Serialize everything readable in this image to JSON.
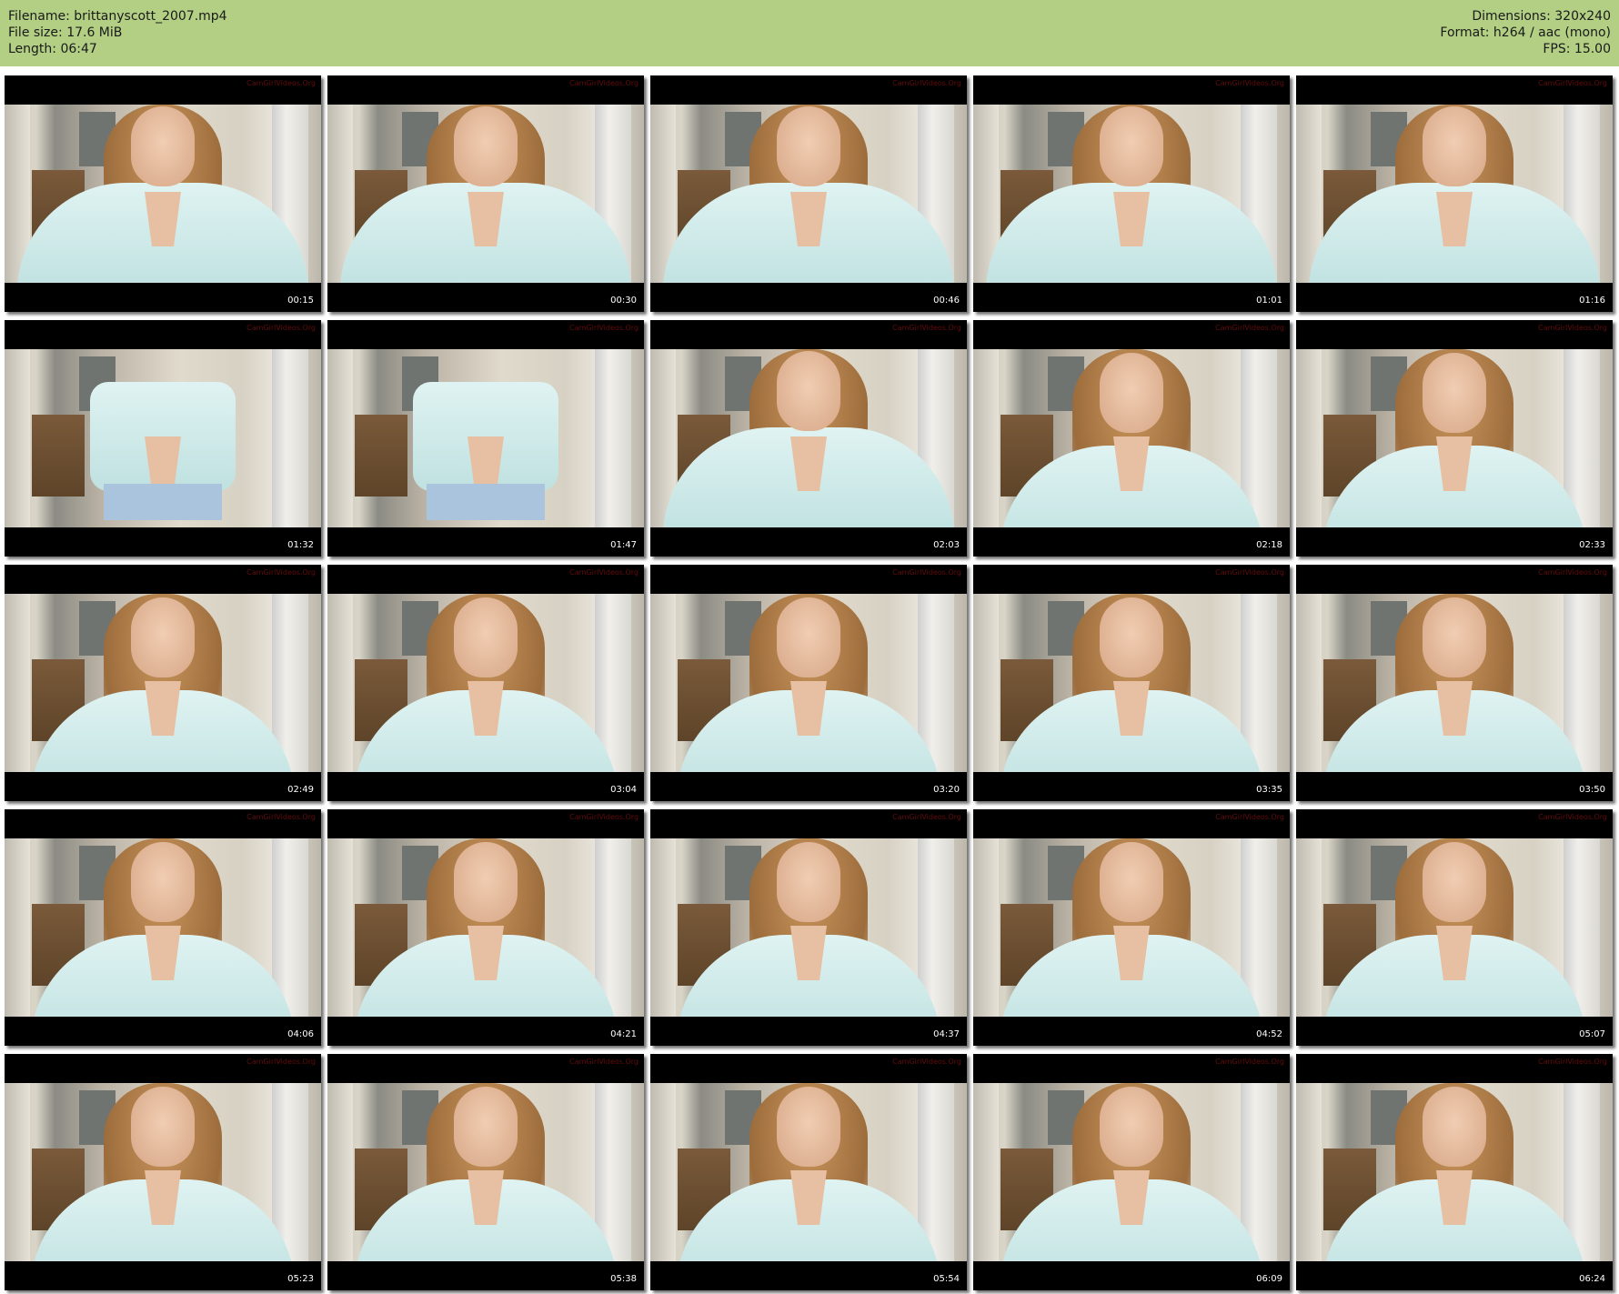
{
  "header": {
    "filename_line": "Filename: brittanyscott_2007.mp4",
    "filesize_line": "File size: 17.6 MiB",
    "length_line": "Length: 06:47",
    "dimensions_line": "Dimensions: 320x240",
    "format_line": "Format: h264 / aac (mono)",
    "fps_line": "FPS: 15.00",
    "background_color": "#b2cf84"
  },
  "watermark_text": "CamGirlVideos.Org",
  "thumbnails": [
    {
      "time": "00:15",
      "scene": "lean"
    },
    {
      "time": "00:30",
      "scene": "lean"
    },
    {
      "time": "00:46",
      "scene": "lean"
    },
    {
      "time": "01:01",
      "scene": "lean"
    },
    {
      "time": "01:16",
      "scene": "lean"
    },
    {
      "time": "01:32",
      "scene": "body"
    },
    {
      "time": "01:47",
      "scene": "body"
    },
    {
      "time": "02:03",
      "scene": "lean"
    },
    {
      "time": "02:18",
      "scene": "seated"
    },
    {
      "time": "02:33",
      "scene": "seated"
    },
    {
      "time": "02:49",
      "scene": "seated"
    },
    {
      "time": "03:04",
      "scene": "seated"
    },
    {
      "time": "03:20",
      "scene": "seated"
    },
    {
      "time": "03:35",
      "scene": "seated"
    },
    {
      "time": "03:50",
      "scene": "seated"
    },
    {
      "time": "04:06",
      "scene": "seated"
    },
    {
      "time": "04:21",
      "scene": "seated"
    },
    {
      "time": "04:37",
      "scene": "seated"
    },
    {
      "time": "04:52",
      "scene": "seated"
    },
    {
      "time": "05:07",
      "scene": "seated"
    },
    {
      "time": "05:23",
      "scene": "seated"
    },
    {
      "time": "05:38",
      "scene": "seated"
    },
    {
      "time": "05:54",
      "scene": "seated"
    },
    {
      "time": "06:09",
      "scene": "seated"
    },
    {
      "time": "06:24",
      "scene": "seated"
    }
  ]
}
